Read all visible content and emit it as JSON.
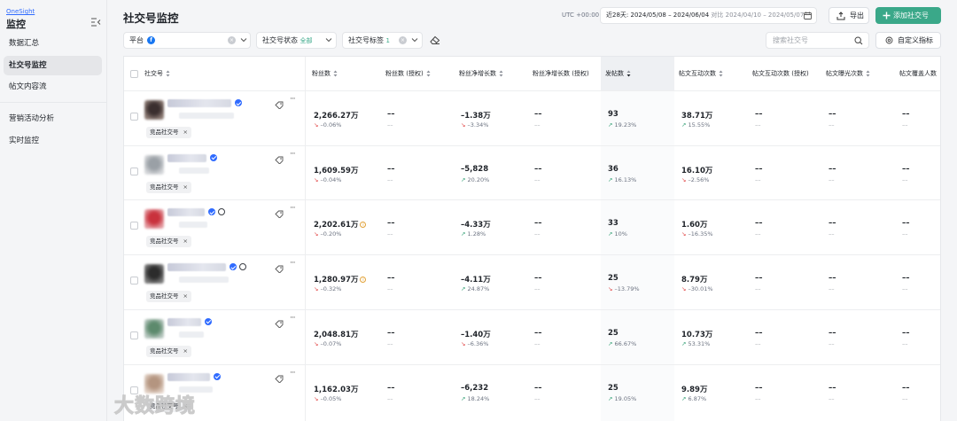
{
  "sidebar": {
    "brand": "OneSight",
    "title": "监控",
    "items": [
      {
        "label": "数据汇总",
        "active": false
      },
      {
        "label": "社交号监控",
        "active": true
      },
      {
        "label": "帖文内容流",
        "active": false
      },
      {
        "label": "营销活动分析",
        "active": false
      },
      {
        "label": "实时监控",
        "active": false
      }
    ]
  },
  "header": {
    "title": "社交号监控",
    "timezone": "UTC +00:00",
    "date_range": {
      "prefix": "近28天:",
      "range": "2024/05/08 – 2024/06/04",
      "compare_label": "对比",
      "compare_range": "2024/04/10 – 2024/05/07"
    },
    "export_label": "导出",
    "add_label": "添加社交号"
  },
  "filters": {
    "platform_label": "平台",
    "platform_icon": "facebook-icon",
    "status_label": "社交号状态",
    "status_value": "全部",
    "tag_label": "社交号标签",
    "tag_count": "1",
    "search_placeholder": "搜索社交号",
    "custom_label": "自定义指标"
  },
  "table": {
    "columns": [
      "社交号",
      "粉丝数",
      "粉丝数 (授权)",
      "粉丝净增长数",
      "粉丝净增长数 (授权)",
      "发帖数",
      "帖文互动次数",
      "帖文互动次数 (授权)",
      "帖文曝光次数",
      "帖文覆盖人数"
    ],
    "sorted_column": "发帖数",
    "empty_value": "––",
    "rows": [
      {
        "tag": "竞品社交号",
        "globe": false,
        "fans": "2,266.27万",
        "fans_delta": "–0.06%",
        "fans_dir": "down",
        "fans_warn": false,
        "growth": "–1.38万",
        "growth_delta": "–3.34%",
        "growth_dir": "down",
        "posts": "93",
        "posts_delta": "19.23%",
        "posts_dir": "up",
        "inter": "38.71万",
        "inter_delta": "15.55%",
        "inter_dir": "up"
      },
      {
        "tag": "竞品社交号",
        "globe": false,
        "fans": "1,609.59万",
        "fans_delta": "–0.04%",
        "fans_dir": "down",
        "fans_warn": false,
        "growth": "–5,828",
        "growth_delta": "20.20%",
        "growth_dir": "up",
        "posts": "36",
        "posts_delta": "16.13%",
        "posts_dir": "up",
        "inter": "16.10万",
        "inter_delta": "–2.56%",
        "inter_dir": "down"
      },
      {
        "tag": "竞品社交号",
        "globe": true,
        "fans": "2,202.61万",
        "fans_delta": "–0.20%",
        "fans_dir": "down",
        "fans_warn": true,
        "growth": "–4.33万",
        "growth_delta": "1.28%",
        "growth_dir": "up",
        "posts": "33",
        "posts_delta": "10%",
        "posts_dir": "up",
        "inter": "1.60万",
        "inter_delta": "–16.35%",
        "inter_dir": "down"
      },
      {
        "tag": "竞品社交号",
        "globe": true,
        "fans": "1,280.97万",
        "fans_delta": "–0.32%",
        "fans_dir": "down",
        "fans_warn": true,
        "growth": "–4.11万",
        "growth_delta": "24.87%",
        "growth_dir": "up",
        "posts": "25",
        "posts_delta": "–13.79%",
        "posts_dir": "down",
        "inter": "8.79万",
        "inter_delta": "–30.01%",
        "inter_dir": "down"
      },
      {
        "tag": "竞品社交号",
        "globe": false,
        "fans": "2,048.81万",
        "fans_delta": "–0.07%",
        "fans_dir": "down",
        "fans_warn": false,
        "growth": "–1.40万",
        "growth_delta": "–6.36%",
        "growth_dir": "down",
        "posts": "25",
        "posts_delta": "66.67%",
        "posts_dir": "up",
        "inter": "10.73万",
        "inter_delta": "53.31%",
        "inter_dir": "up"
      },
      {
        "tag": "竞品社交号",
        "globe": false,
        "fans": "1,162.03万",
        "fans_delta": "–0.05%",
        "fans_dir": "down",
        "fans_warn": false,
        "growth": "–6,232",
        "growth_delta": "18.24%",
        "growth_dir": "up",
        "posts": "25",
        "posts_delta": "19.05%",
        "posts_dir": "up",
        "inter": "9.89万",
        "inter_delta": "6.87%",
        "inter_dir": "up"
      }
    ]
  },
  "watermark": "大数跨境",
  "colors": {
    "accent": "#3aa889",
    "up": "#2f9e72",
    "down": "#e24b4b",
    "verified": "#2f6bff",
    "facebook": "#1877f2"
  }
}
